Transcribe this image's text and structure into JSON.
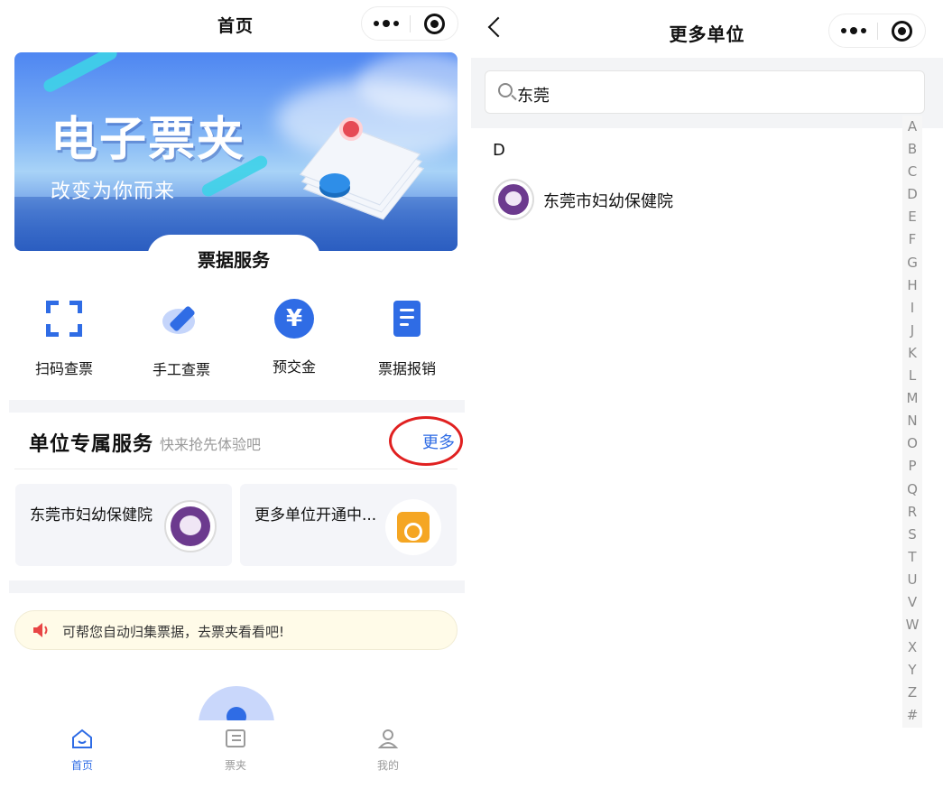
{
  "left": {
    "title": "首页",
    "banner": {
      "heading": "电子票夹",
      "subheading": "改变为你而来"
    },
    "services_title": "票据服务",
    "services": [
      {
        "label": "扫码查票",
        "icon": "scan-icon"
      },
      {
        "label": "手工查票",
        "icon": "pen-icon"
      },
      {
        "label": "预交金",
        "icon": "yen-icon"
      },
      {
        "label": "票据报销",
        "icon": "receipt-icon"
      }
    ],
    "unit_section": {
      "title": "单位专属服务",
      "subtitle": "快来抢先体验吧",
      "more": "更多"
    },
    "cards": [
      {
        "label": "东莞市妇幼保健院",
        "icon": "hospital-logo"
      },
      {
        "label": "更多单位开通中...",
        "icon": "calendar-icon"
      }
    ],
    "notice": "可帮您自动归集票据，去票夹看看吧!",
    "tabs": [
      {
        "label": "首页",
        "icon": "home-icon",
        "active": true
      },
      {
        "label": "票夹",
        "icon": "wallet-icon",
        "active": false
      },
      {
        "label": "我的",
        "icon": "user-icon",
        "active": false
      }
    ]
  },
  "right": {
    "title": "更多单位",
    "search": {
      "value": "东莞"
    },
    "groups": [
      {
        "letter": "D",
        "items": [
          "东莞市妇幼保健院"
        ]
      }
    ],
    "index": [
      "A",
      "B",
      "C",
      "D",
      "E",
      "F",
      "G",
      "H",
      "I",
      "J",
      "K",
      "L",
      "M",
      "N",
      "O",
      "P",
      "Q",
      "R",
      "S",
      "T",
      "U",
      "V",
      "W",
      "X",
      "Y",
      "Z",
      "#"
    ]
  },
  "colors": {
    "accent": "#2f6ce5",
    "highlight_ring": "#e02020",
    "notice_bg": "#fffbe8"
  }
}
